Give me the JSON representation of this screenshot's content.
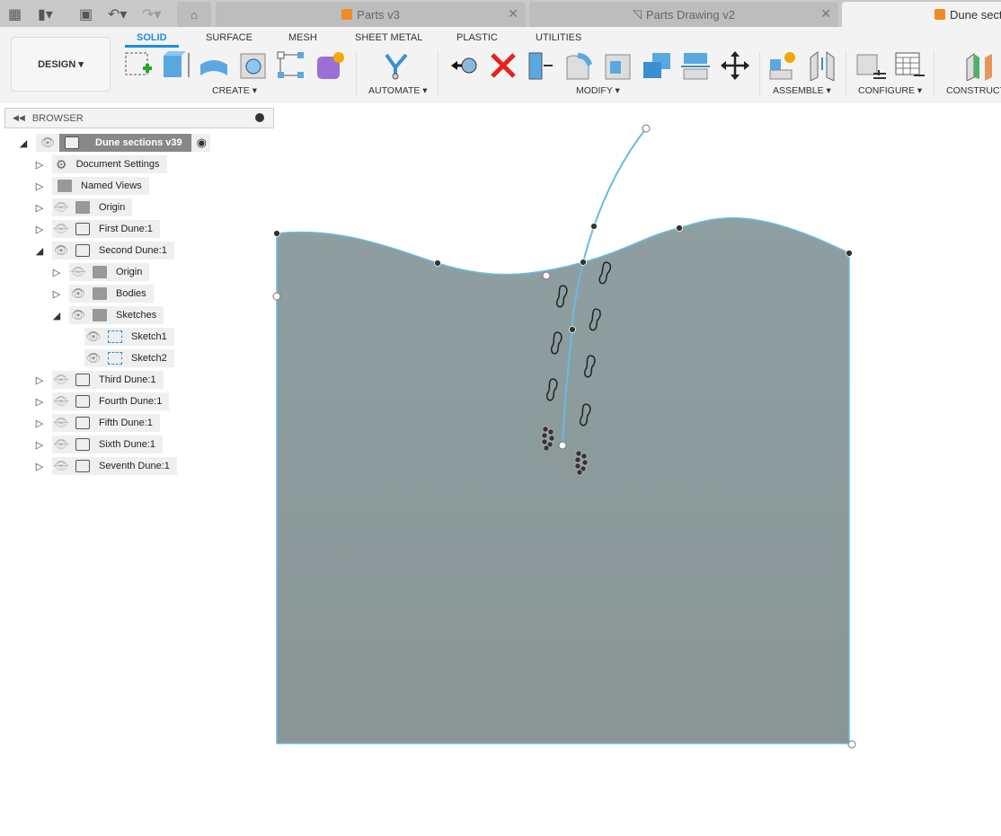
{
  "topbar": {
    "tabs": [
      {
        "label": "Parts v3"
      },
      {
        "label": "Parts Drawing v2"
      },
      {
        "label": "Dune sect"
      }
    ],
    "icons": [
      "grid-icon",
      "file-icon",
      "save-icon",
      "undo-icon",
      "redo-icon",
      "home-icon"
    ]
  },
  "toolbar": {
    "workspace": "DESIGN ▾",
    "ribbon_tabs": [
      "SOLID",
      "SURFACE",
      "MESH",
      "SHEET METAL",
      "PLASTIC",
      "UTILITIES"
    ],
    "groups": [
      "CREATE ▾",
      "AUTOMATE ▾",
      "MODIFY ▾",
      "ASSEMBLE ▾",
      "CONFIGURE ▾",
      "CONSTRUCT"
    ]
  },
  "browser": {
    "title": "BROWSER",
    "root": "Dune sections v39",
    "items": [
      {
        "label": "Document Settings",
        "icon": "gear-icon",
        "level": 1
      },
      {
        "label": "Named Views",
        "icon": "folder-icon",
        "level": 1
      },
      {
        "label": "Origin",
        "icon": "folder-icon",
        "level": 1,
        "visible": false
      },
      {
        "label": "First Dune:1",
        "icon": "body-icon",
        "level": 1,
        "visible": false
      },
      {
        "label": "Second Dune:1",
        "icon": "body-icon",
        "level": 1,
        "visible": true,
        "expanded": true
      },
      {
        "label": "Origin",
        "icon": "folder-icon",
        "level": 2,
        "visible": false
      },
      {
        "label": "Bodies",
        "icon": "folder-icon",
        "level": 2,
        "visible": true
      },
      {
        "label": "Sketches",
        "icon": "folder-icon",
        "level": 2,
        "visible": true,
        "expanded": true
      },
      {
        "label": "Sketch1",
        "icon": "sketch-icon",
        "level": 3,
        "visible": true
      },
      {
        "label": "Sketch2",
        "icon": "sketch-icon",
        "level": 3,
        "visible": true
      },
      {
        "label": "Third Dune:1",
        "icon": "body-icon",
        "level": 1,
        "visible": false
      },
      {
        "label": "Fourth Dune:1",
        "icon": "body-icon",
        "level": 1,
        "visible": false
      },
      {
        "label": "Fifth Dune:1",
        "icon": "body-icon",
        "level": 1,
        "visible": false
      },
      {
        "label": "Sixth Dune:1",
        "icon": "body-icon",
        "level": 1,
        "visible": false
      },
      {
        "label": "Seventh Dune:1",
        "icon": "body-icon",
        "level": 1,
        "visible": false
      }
    ]
  },
  "colors": {
    "accent": "#1e8fd6",
    "sketch_line": "#6bbbe0",
    "body_fill": "#8a9c9d"
  }
}
